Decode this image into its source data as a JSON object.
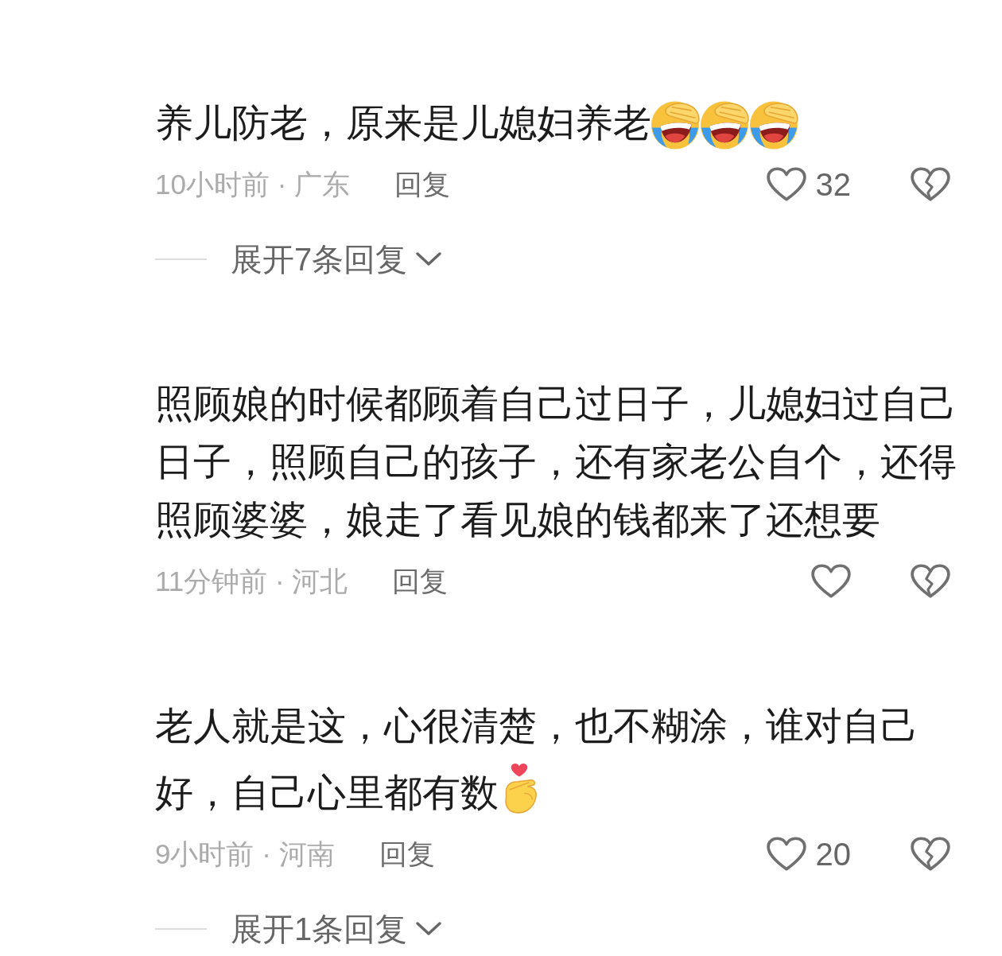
{
  "comments": [
    {
      "text": "养儿防老，原来是儿媳妇养老",
      "emojis": [
        {
          "kind": "facepalm"
        },
        {
          "kind": "facepalm"
        },
        {
          "kind": "facepalm"
        }
      ],
      "meta": "10小时前 · 广东",
      "reply_label": "回复",
      "like_count": "32",
      "expand_label": "展开7条回复"
    },
    {
      "text": "照顾娘的时候都顾着自己过日子，儿媳妇过自己日子，照顾自己的孩子，还有家老公自个，还得照顾婆婆，娘走了看见娘的钱都来了还想要",
      "meta": "11分钟前 · 河北",
      "reply_label": "回复"
    },
    {
      "text": "老人就是这，心很清楚，也不糊涂，谁对自己好，自己心里都有数",
      "emojis": [
        {
          "kind": "finger_heart"
        }
      ],
      "meta": "9小时前 · 河南",
      "reply_label": "回复",
      "like_count": "20",
      "expand_label": "展开1条回复"
    }
  ]
}
